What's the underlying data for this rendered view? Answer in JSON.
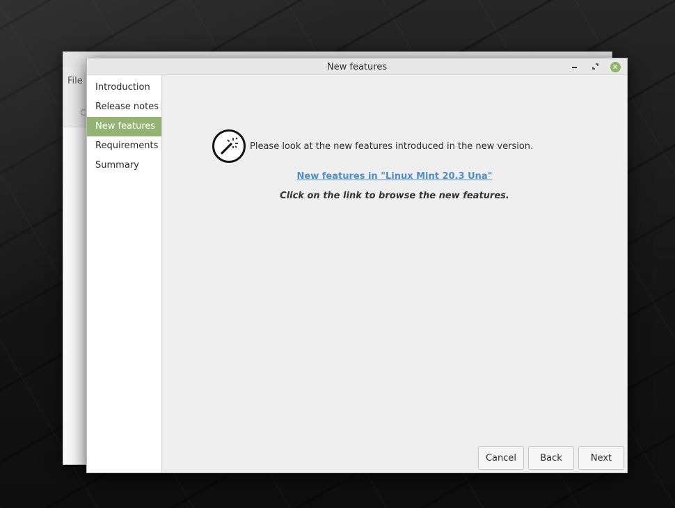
{
  "background_window": {
    "menu_file": "File",
    "toolbar_label": "C"
  },
  "dialog": {
    "title": "New features",
    "controls": {
      "minimize_icon": "minimize-icon",
      "maximize_icon": "maximize-icon",
      "close_icon": "close-icon",
      "close_color": "#8fb46a"
    }
  },
  "sidebar": {
    "items": [
      {
        "label": "Introduction"
      },
      {
        "label": "Release notes"
      },
      {
        "label": "New features"
      },
      {
        "label": "Requirements"
      },
      {
        "label": "Summary"
      }
    ],
    "active_index": 2,
    "active_color": "#92b372"
  },
  "main": {
    "icon": "magic-wand-icon",
    "intro": "Please look at the new features introduced in the new version.",
    "link": "New features in \"Linux Mint 20.3 Una\"",
    "hint": "Click on the link to browse the new features."
  },
  "buttons": {
    "cancel": "Cancel",
    "back": "Back",
    "next": "Next"
  },
  "colors": {
    "link": "#4f8fc9",
    "accent": "#92b372"
  }
}
